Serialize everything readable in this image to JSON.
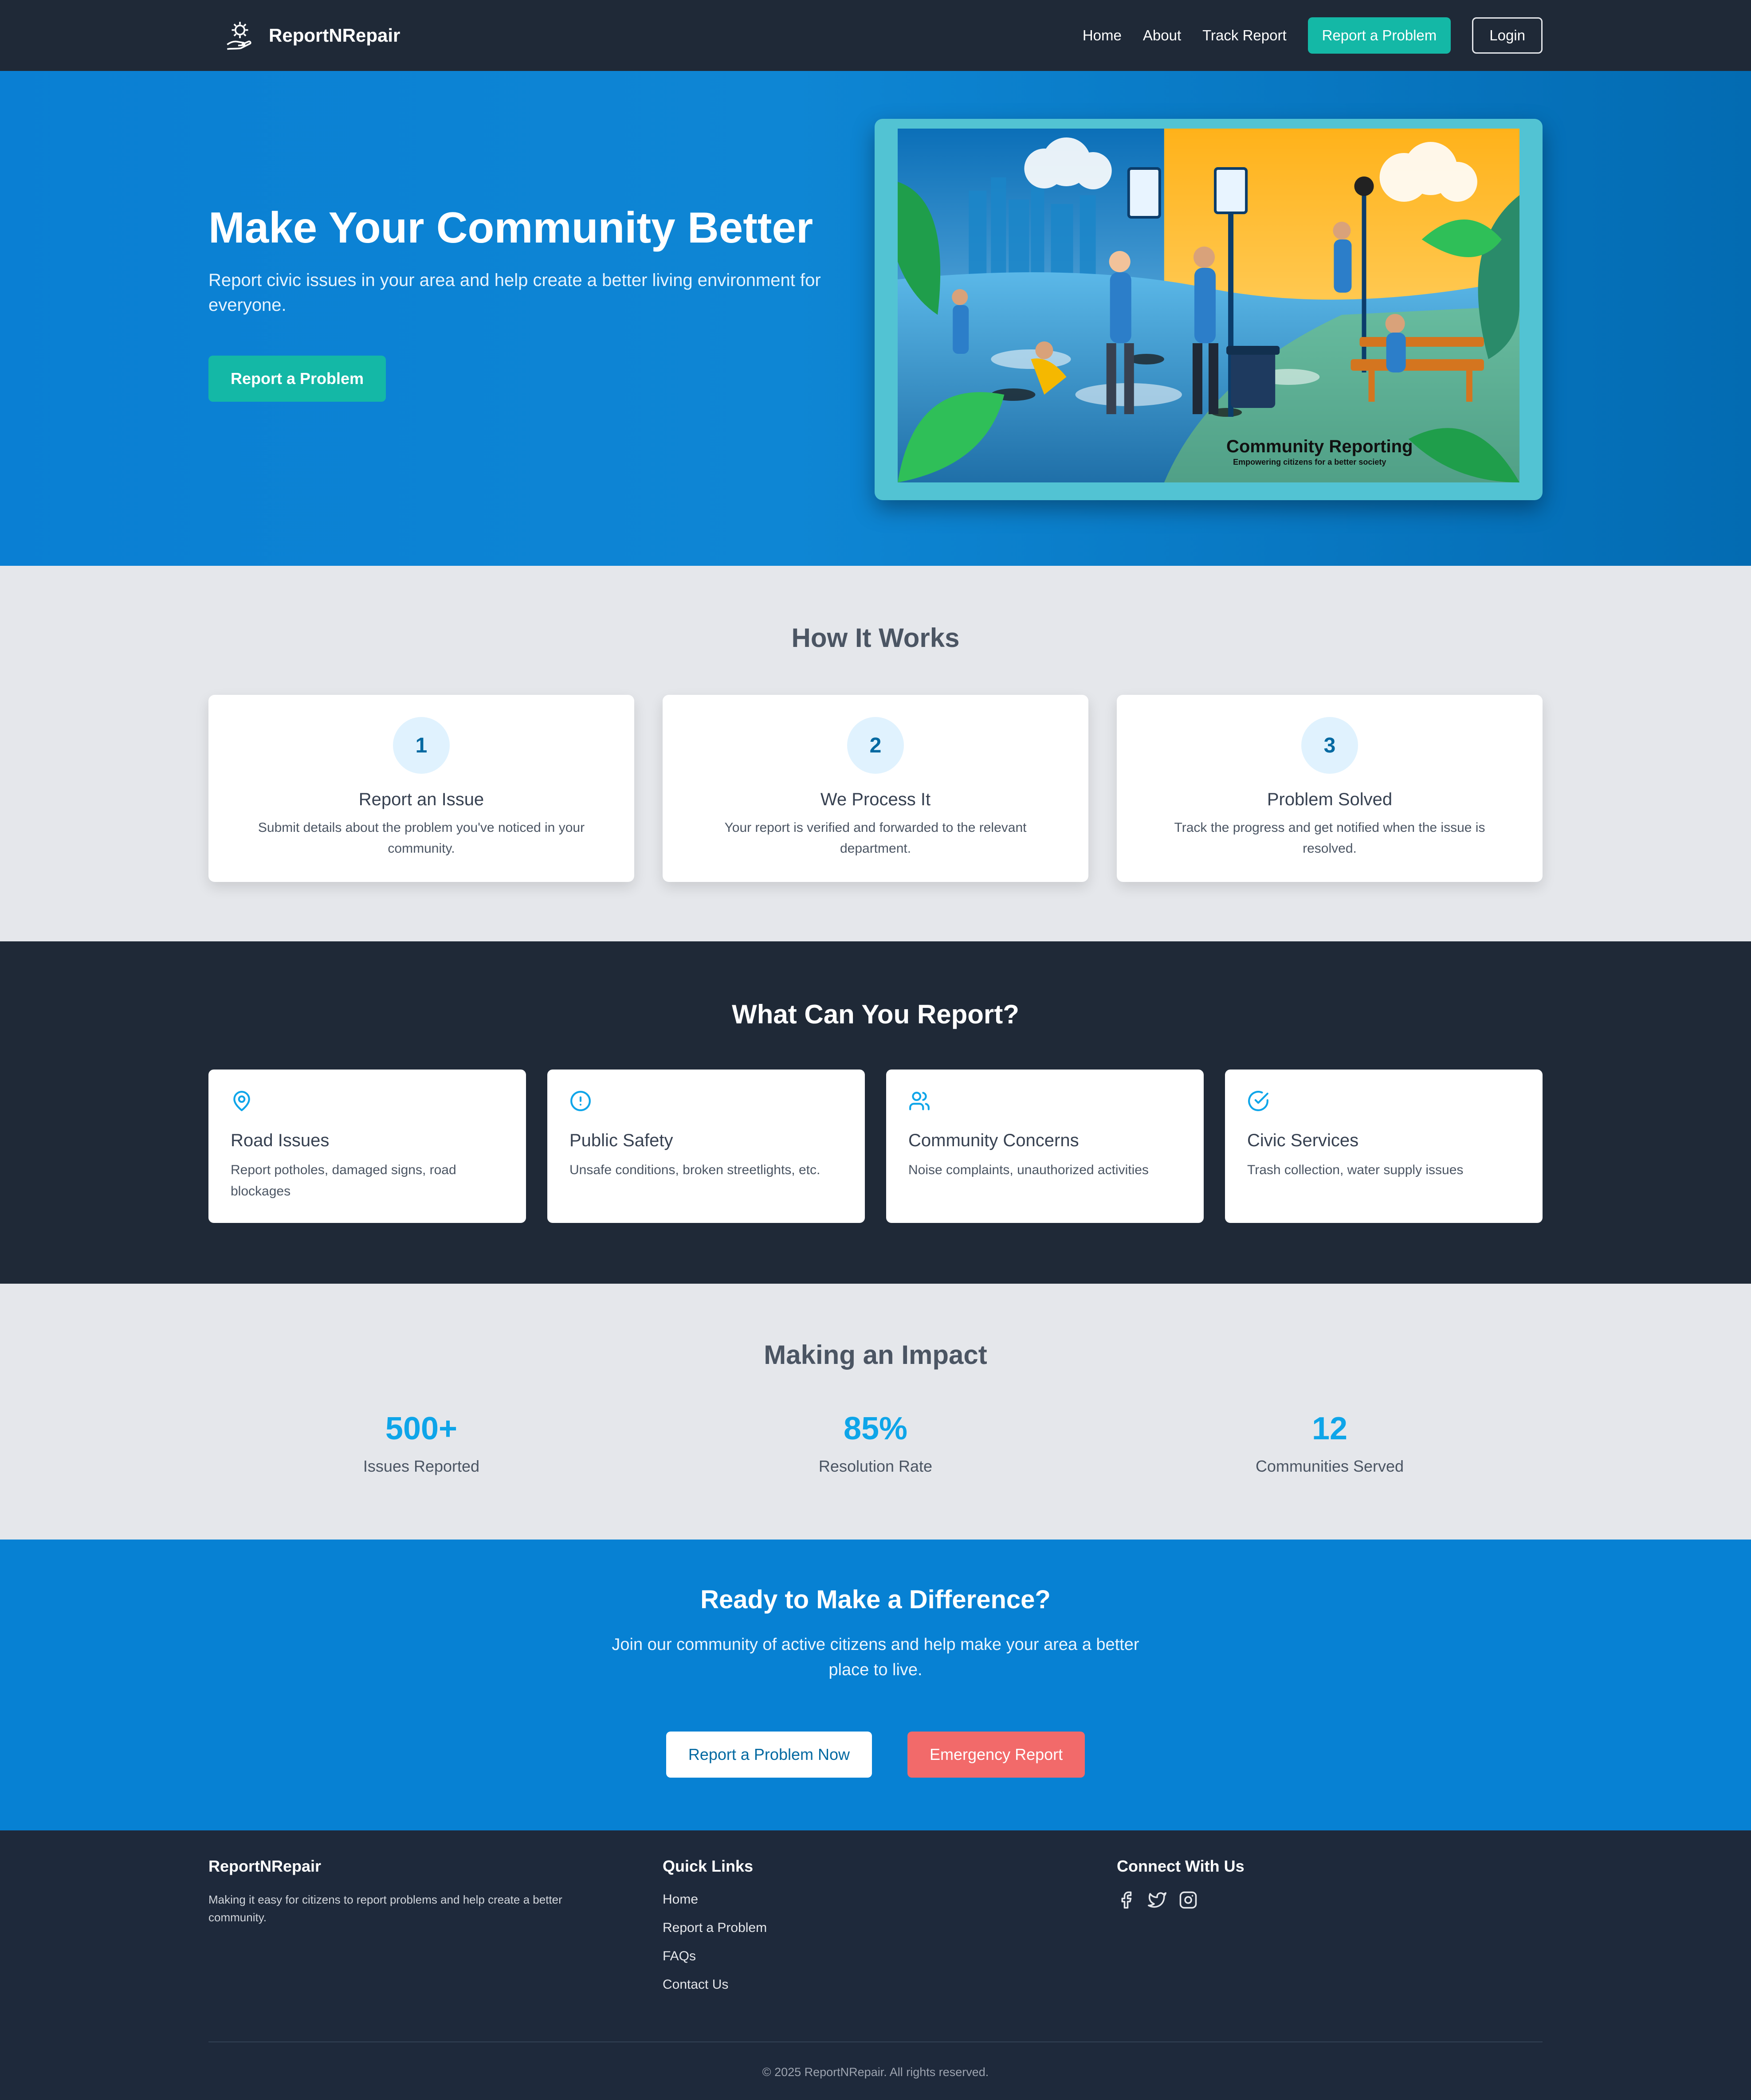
{
  "nav": {
    "brand": "ReportNRepair",
    "links": [
      "Home",
      "About",
      "Track Report"
    ],
    "report_button": "Report a Problem",
    "login_button": "Login"
  },
  "hero": {
    "title": "Make Your Community Better",
    "subtitle": "Report civic issues in your area and help create a better living environment for everyone.",
    "cta": "Report a Problem",
    "image_caption": "Community Reporting",
    "image_subcaption": "Empowering citizens for a better society"
  },
  "how": {
    "title": "How It Works",
    "steps": [
      {
        "num": "1",
        "title": "Report an Issue",
        "desc": "Submit details about the problem you've noticed in your community."
      },
      {
        "num": "2",
        "title": "We Process It",
        "desc": "Your report is verified and forwarded to the relevant department."
      },
      {
        "num": "3",
        "title": "Problem Solved",
        "desc": "Track the progress and get notified when the issue is resolved."
      }
    ]
  },
  "report": {
    "title": "What Can You Report?",
    "categories": [
      {
        "icon": "map-pin-icon",
        "title": "Road Issues",
        "desc": "Report potholes, damaged signs, road blockages"
      },
      {
        "icon": "alert-circle-icon",
        "title": "Public Safety",
        "desc": "Unsafe conditions, broken streetlights, etc."
      },
      {
        "icon": "users-icon",
        "title": "Community Concerns",
        "desc": "Noise complaints, unauthorized activities"
      },
      {
        "icon": "check-circle-icon",
        "title": "Civic Services",
        "desc": "Trash collection, water supply issues"
      }
    ]
  },
  "impact": {
    "title": "Making an Impact",
    "stats": [
      {
        "value": "500+",
        "label": "Issues Reported"
      },
      {
        "value": "85%",
        "label": "Resolution Rate"
      },
      {
        "value": "12",
        "label": "Communities Served"
      }
    ]
  },
  "cta": {
    "title": "Ready to Make a Difference?",
    "subtitle": "Join our community of active citizens and help make your area a better place to live.",
    "primary": "Report a Problem Now",
    "emergency": "Emergency Report"
  },
  "footer": {
    "brand": "ReportNRepair",
    "tagline": "Making it easy for citizens to report problems and help create a better community.",
    "quick_links_title": "Quick Links",
    "quick_links": [
      "Home",
      "Report a Problem",
      "FAQs",
      "Contact Us"
    ],
    "connect_title": "Connect With Us",
    "social": [
      "facebook-icon",
      "twitter-icon",
      "instagram-icon"
    ],
    "copyright": "© 2025 ReportNRepair. All rights reserved."
  },
  "colors": {
    "primary_blue": "#0781d3",
    "teal": "#14b8a6",
    "dark": "#1f2937",
    "emergency_red": "#f26a6a",
    "stat_blue": "#0ea5e9"
  }
}
